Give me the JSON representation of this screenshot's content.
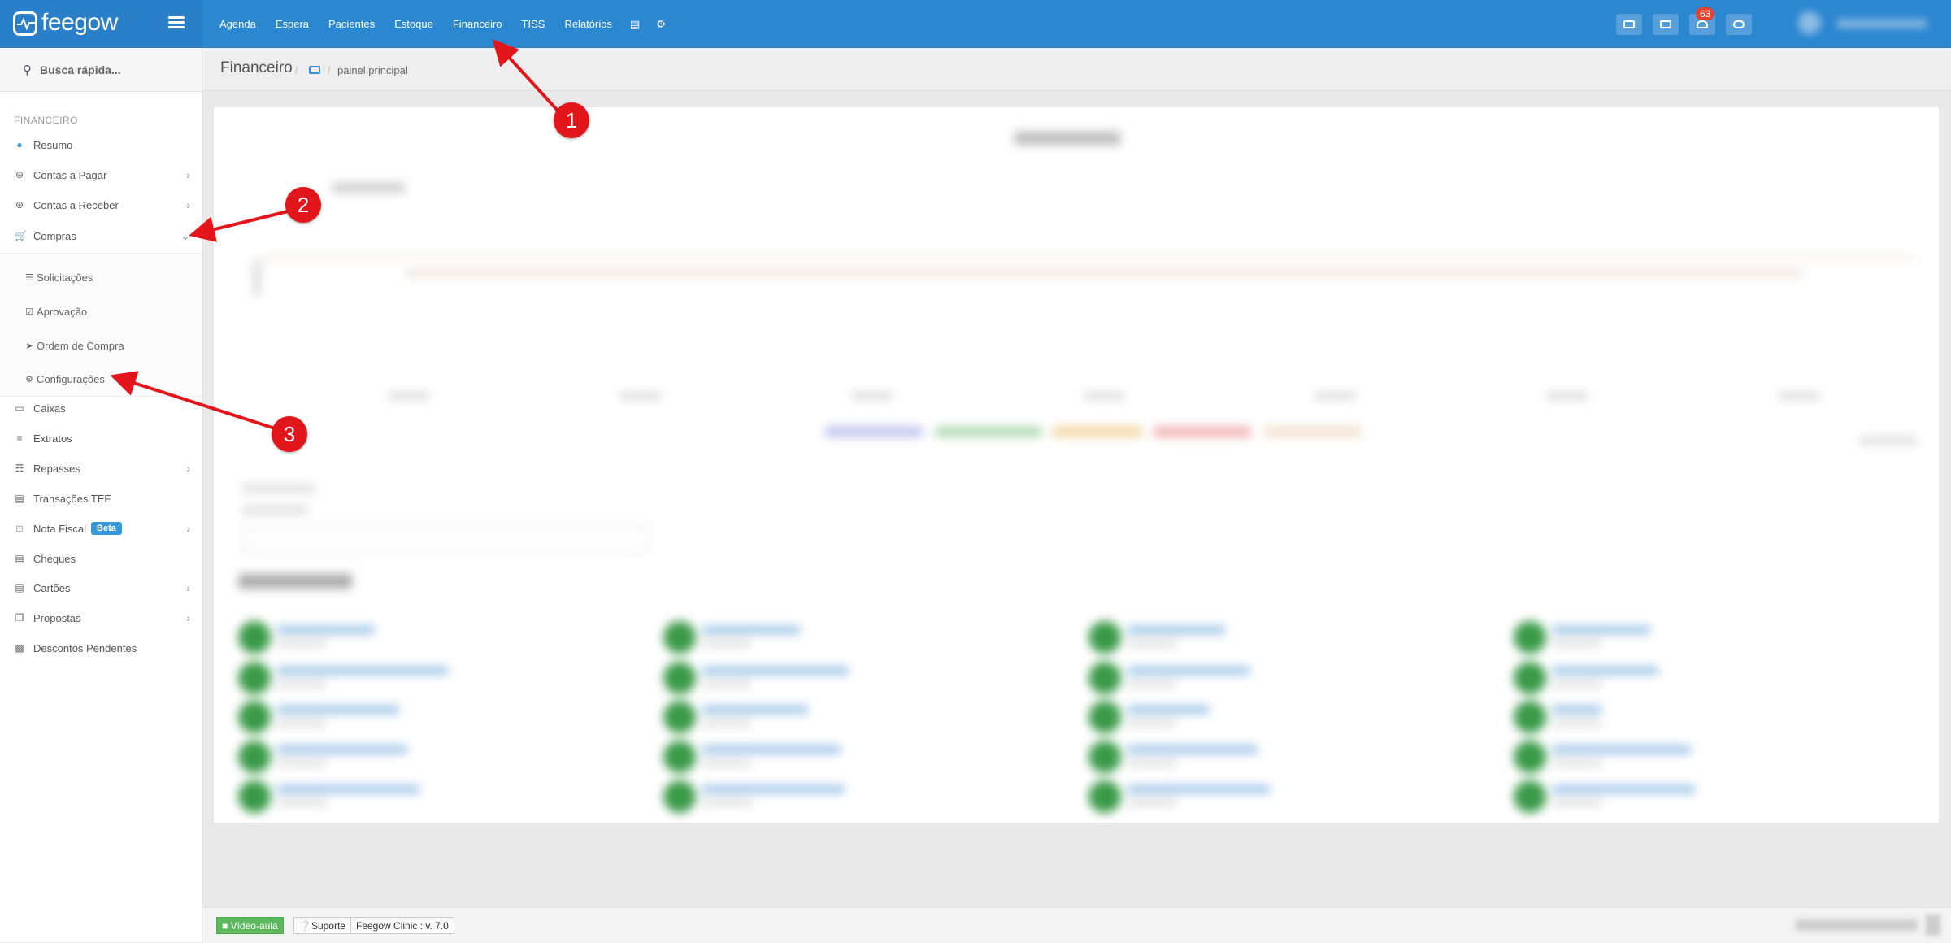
{
  "brand": {
    "name": "feegow"
  },
  "topnav": {
    "items": [
      "Agenda",
      "Espera",
      "Pacientes",
      "Estoque",
      "Financeiro",
      "TISS",
      "Relatórios"
    ],
    "database_icon": "database-icon",
    "settings_icon": "gear-icon"
  },
  "topbar": {
    "notifications_count": "63"
  },
  "sidebar": {
    "quick_search": "Busca rápida...",
    "section_title": "FINANCEIRO",
    "items": [
      {
        "label": "Resumo",
        "icon": "pie-chart-icon"
      },
      {
        "label": "Contas a Pagar",
        "icon": "minus-circle-icon"
      },
      {
        "label": "Contas a Receber",
        "icon": "plus-circle-icon"
      },
      {
        "label": "Compras",
        "icon": "cart-icon"
      },
      {
        "label": "Caixas",
        "icon": "inbox-icon"
      },
      {
        "label": "Extratos",
        "icon": "list-icon"
      },
      {
        "label": "Repasses",
        "icon": "sitemap-icon"
      },
      {
        "label": "Transações TEF",
        "icon": "credit-card-icon"
      },
      {
        "label": "Nota Fiscal",
        "icon": "file-icon"
      },
      {
        "label": "Cheques",
        "icon": "money-check-icon"
      },
      {
        "label": "Cartões",
        "icon": "credit-card-icon"
      },
      {
        "label": "Propostas",
        "icon": "copy-icon"
      },
      {
        "label": "Descontos Pendentes",
        "icon": "money-icon"
      }
    ],
    "submenu": [
      {
        "label": "Solicitações",
        "icon": "list-icon"
      },
      {
        "label": "Aprovação",
        "icon": "check-square-icon"
      },
      {
        "label": "Ordem de Compra",
        "icon": "paper-plane-icon"
      },
      {
        "label": "Configurações",
        "icon": "gear-icon"
      }
    ],
    "beta_badge": "Beta"
  },
  "breadcrumb": {
    "title": "Financeiro",
    "current": "painel principal"
  },
  "footer": {
    "video_label": "Vídeo-aula",
    "support_label": "Suporte",
    "version_label": "Feegow Clinic : v. 7.0"
  },
  "annotations": {
    "markers": [
      "1",
      "2",
      "3"
    ],
    "color": "#e2161a"
  },
  "colors": {
    "topbar": "#2c87d1",
    "accent": "#3498db",
    "video_button": "#5cb85c"
  }
}
